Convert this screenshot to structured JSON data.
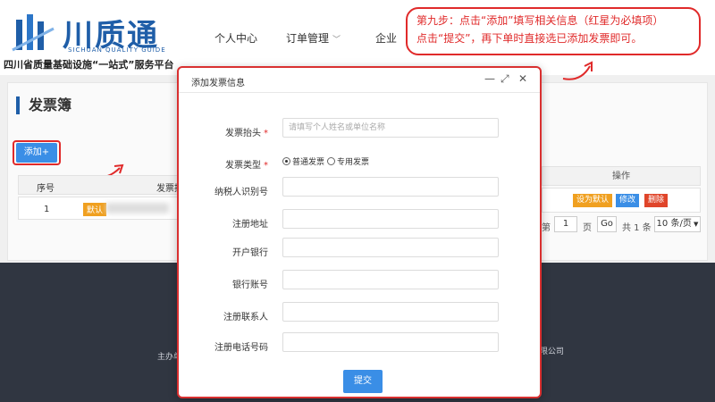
{
  "header": {
    "logo_title": "川质通",
    "logo_subtitle": "SICHUAN QUALITY GUIDE",
    "platform": "四川省质量基础设施“一站式”服务平台",
    "nav": [
      "个人中心",
      "订单管理",
      "企业"
    ]
  },
  "callout": {
    "line1": "第九步：点击“添加”填写相关信息（红星为必填项）",
    "line2": "点击“提交”，再下单时直接选已添加发票即可。"
  },
  "page": {
    "title": "发票簿",
    "add_button": "添加+",
    "table": {
      "headers": [
        "序号",
        "发票抬"
      ],
      "rows": [
        {
          "no": "1",
          "tag": "默认"
        }
      ]
    },
    "ops": {
      "header": "操作",
      "buttons": [
        "设为默认",
        "修改",
        "删除"
      ]
    },
    "pager": {
      "goto_prefix": "第",
      "page": "1",
      "page_suffix": "页",
      "go": "Go",
      "total": "共 1 条",
      "per_page": "10 条/页"
    }
  },
  "footer": {
    "left": "主办单",
    "right": "限公司"
  },
  "modal": {
    "title": "添加发票信息",
    "fields": [
      {
        "label": "发票抬头",
        "required": "*",
        "placeholder": "请填写个人姓名或单位名称"
      },
      {
        "label": "发票类型",
        "required": "*"
      },
      {
        "label": "纳税人识别号",
        "required": ""
      },
      {
        "label": "注册地址",
        "required": ""
      },
      {
        "label": "开户银行",
        "required": ""
      },
      {
        "label": "银行账号",
        "required": ""
      },
      {
        "label": "注册联系人",
        "required": ""
      },
      {
        "label": "注册电话号码",
        "required": ""
      }
    ],
    "radio": {
      "option1": "普通发票",
      "option2": "专用发票",
      "selected": "普通发票"
    },
    "submit": "提交"
  },
  "colors": {
    "brand": "#1f5ea8",
    "primary": "#3a8ee6",
    "highlight": "#e02a2a"
  }
}
